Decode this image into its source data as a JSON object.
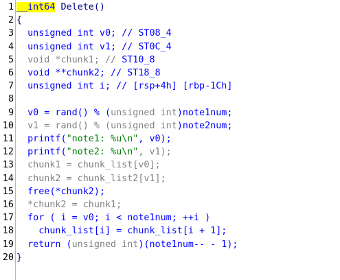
{
  "editor": {
    "lines": [
      {
        "n": "1",
        "tokens": [
          {
            "t": "__int64",
            "c": "hl"
          },
          {
            "t": " Delete()",
            "c": "plain"
          }
        ]
      },
      {
        "n": "2",
        "tokens": [
          {
            "t": "{",
            "c": "plain"
          }
        ]
      },
      {
        "n": "3",
        "tokens": [
          {
            "t": "  unsigned int v0; // ",
            "c": "kw"
          },
          {
            "t": "ST08_4",
            "c": "cm"
          }
        ]
      },
      {
        "n": "4",
        "tokens": [
          {
            "t": "  unsigned int v1; // ",
            "c": "kw"
          },
          {
            "t": "ST0C_4",
            "c": "cm"
          }
        ]
      },
      {
        "n": "5",
        "tokens": [
          {
            "t": "  void *chunk1; // ",
            "c": "gray"
          },
          {
            "t": "ST10_8",
            "c": "cm"
          }
        ]
      },
      {
        "n": "6",
        "tokens": [
          {
            "t": "  void **chunk2; // ",
            "c": "kw"
          },
          {
            "t": "ST18_8",
            "c": "cm"
          }
        ]
      },
      {
        "n": "7",
        "tokens": [
          {
            "t": "  unsigned int i; // ",
            "c": "kw"
          },
          {
            "t": "[rsp+4h] [rbp-1Ch]",
            "c": "cm"
          }
        ]
      },
      {
        "n": "8",
        "tokens": [
          {
            "t": "",
            "c": "plain"
          }
        ]
      },
      {
        "n": "9",
        "tokens": [
          {
            "t": "  v0 = rand() % (",
            "c": "fn"
          },
          {
            "t": "unsigned int",
            "c": "gtp"
          },
          {
            "t": ")note1num;",
            "c": "fn"
          }
        ]
      },
      {
        "n": "10",
        "tokens": [
          {
            "t": "  v1 = rand() % (",
            "c": "gray"
          },
          {
            "t": "unsigned int",
            "c": "gtp"
          },
          {
            "t": ")note2num;",
            "c": "fn"
          }
        ]
      },
      {
        "n": "11",
        "tokens": [
          {
            "t": "  printf(",
            "c": "fn"
          },
          {
            "t": "\"note1: %u\\n\"",
            "c": "str"
          },
          {
            "t": ", v0);",
            "c": "fn"
          }
        ]
      },
      {
        "n": "12",
        "tokens": [
          {
            "t": "  printf(",
            "c": "fn"
          },
          {
            "t": "\"note2: %u\\n\"",
            "c": "str"
          },
          {
            "t": ", v1);",
            "c": "gray"
          }
        ]
      },
      {
        "n": "13",
        "tokens": [
          {
            "t": "  chunk1 = chunk_list[v0];",
            "c": "gray"
          }
        ]
      },
      {
        "n": "14",
        "tokens": [
          {
            "t": "  chunk2 = chunk_list2[v1];",
            "c": "gray"
          }
        ]
      },
      {
        "n": "15",
        "tokens": [
          {
            "t": "  free(*chunk2);",
            "c": "fn"
          }
        ]
      },
      {
        "n": "16",
        "tokens": [
          {
            "t": "  *chunk2 = chunk1;",
            "c": "gray"
          }
        ]
      },
      {
        "n": "17",
        "tokens": [
          {
            "t": "  for ( i = v0; i < note1num; ++i )",
            "c": "fn"
          }
        ]
      },
      {
        "n": "18",
        "tokens": [
          {
            "t": "    chunk_list[i] = chunk_list[i + 1];",
            "c": "fn"
          }
        ]
      },
      {
        "n": "19",
        "tokens": [
          {
            "t": "  return (",
            "c": "fn"
          },
          {
            "t": "unsigned int",
            "c": "gtp"
          },
          {
            "t": ")(note1num-- - 1);",
            "c": "fn"
          }
        ]
      },
      {
        "n": "20",
        "tokens": [
          {
            "t": "}",
            "c": "plain"
          }
        ]
      }
    ]
  },
  "colors": {
    "keyword": "#0000ff",
    "string": "#008000",
    "gray": "#808080",
    "highlight": "#ffff00"
  }
}
